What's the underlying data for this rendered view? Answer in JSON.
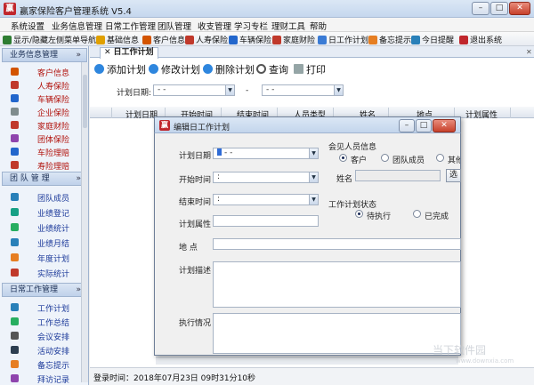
{
  "window": {
    "title": "赢家保险客户管理系统 V5.4",
    "logo": "赢",
    "min": "–",
    "max": "□",
    "close": "✕"
  },
  "menu": [
    "系统设置",
    "业务信息管理",
    "日常工作管理",
    "团队管理",
    "收支管理",
    "学习专栏",
    "理财工具",
    "帮助"
  ],
  "toolbar": [
    {
      "label": "显示/隐藏左侧菜单导航",
      "icon": "layout-icon",
      "color": "#2e7d32"
    },
    {
      "label": "基础信息",
      "icon": "info-icon",
      "color": "#e0a000"
    },
    {
      "label": "客户信息",
      "icon": "customer-icon",
      "color": "#d35400"
    },
    {
      "label": "人寿保险",
      "icon": "life-insurance-icon",
      "color": "#c0392b"
    },
    {
      "label": "车辆保险",
      "icon": "car-icon",
      "color": "#2266cc"
    },
    {
      "label": "家庭财险",
      "icon": "house-icon",
      "color": "#c0392b"
    },
    {
      "label": "日工作计划",
      "icon": "plan-icon",
      "color": "#3a7bd5"
    },
    {
      "label": "备忘提示",
      "icon": "memo-icon",
      "color": "#e67e22"
    },
    {
      "label": "今日提醒",
      "icon": "reminder-icon",
      "color": "#2980b9"
    },
    {
      "label": "退出系统",
      "icon": "exit-icon",
      "color": "#c0262c"
    }
  ],
  "sidebar": {
    "sections": [
      {
        "title": "业务信息管理",
        "collapse": "»",
        "items": [
          "客户信息",
          "人寿保险",
          "车辆保险",
          "企业保险",
          "家庭财险",
          "团体保险",
          "车险理赔",
          "寿险理赔"
        ]
      },
      {
        "title": "团 队 管 理",
        "collapse": "»",
        "items": [
          "团队成员",
          "业绩登记",
          "业绩统计",
          "业绩月结",
          "年度计划",
          "实际统计"
        ]
      },
      {
        "title": "日常工作管理",
        "collapse": "»",
        "items": [
          "工作计划",
          "工作总结",
          "会议安排",
          "活动安排",
          "备忘提示",
          "拜访记录"
        ]
      }
    ]
  },
  "tab": {
    "label": "日工作计划",
    "close": "✕"
  },
  "actions": [
    "添加计划",
    "修改计划",
    "删除计划",
    "查询",
    "打印"
  ],
  "filter": {
    "label": "计划日期:",
    "from": "-   -",
    "sep": "-",
    "to": "-   -"
  },
  "grid": {
    "columns": [
      "计划日期",
      "开始时间",
      "结束时间",
      "人员类型",
      "姓名",
      "地点",
      "计划属性"
    ]
  },
  "status": {
    "text": "登录时间：2018年07月23日 09时31分10秒"
  },
  "dialog": {
    "title": "编辑日工作计划",
    "logo": "赢",
    "fields": {
      "plan_date_label": "计划日期",
      "plan_date_value": "-   -",
      "start_label": "开始时间",
      "start_value": ":",
      "end_label": "结束时间",
      "end_value": ":",
      "attr_label": "计划属性",
      "place_label": "地    点",
      "desc_label": "计划描述",
      "exec_label": "执行情况"
    },
    "people": {
      "title": "会见人员信息",
      "options": [
        "客户",
        "团队成员",
        "其他"
      ],
      "selected": 0,
      "name_label": "姓名",
      "select_button": "选择"
    },
    "status": {
      "title": "工作计划状态",
      "options": [
        "待执行",
        "已完成"
      ],
      "selected": 0
    }
  },
  "watermark": {
    "text": "当下软件园",
    "sub": "www.downxia.com"
  }
}
